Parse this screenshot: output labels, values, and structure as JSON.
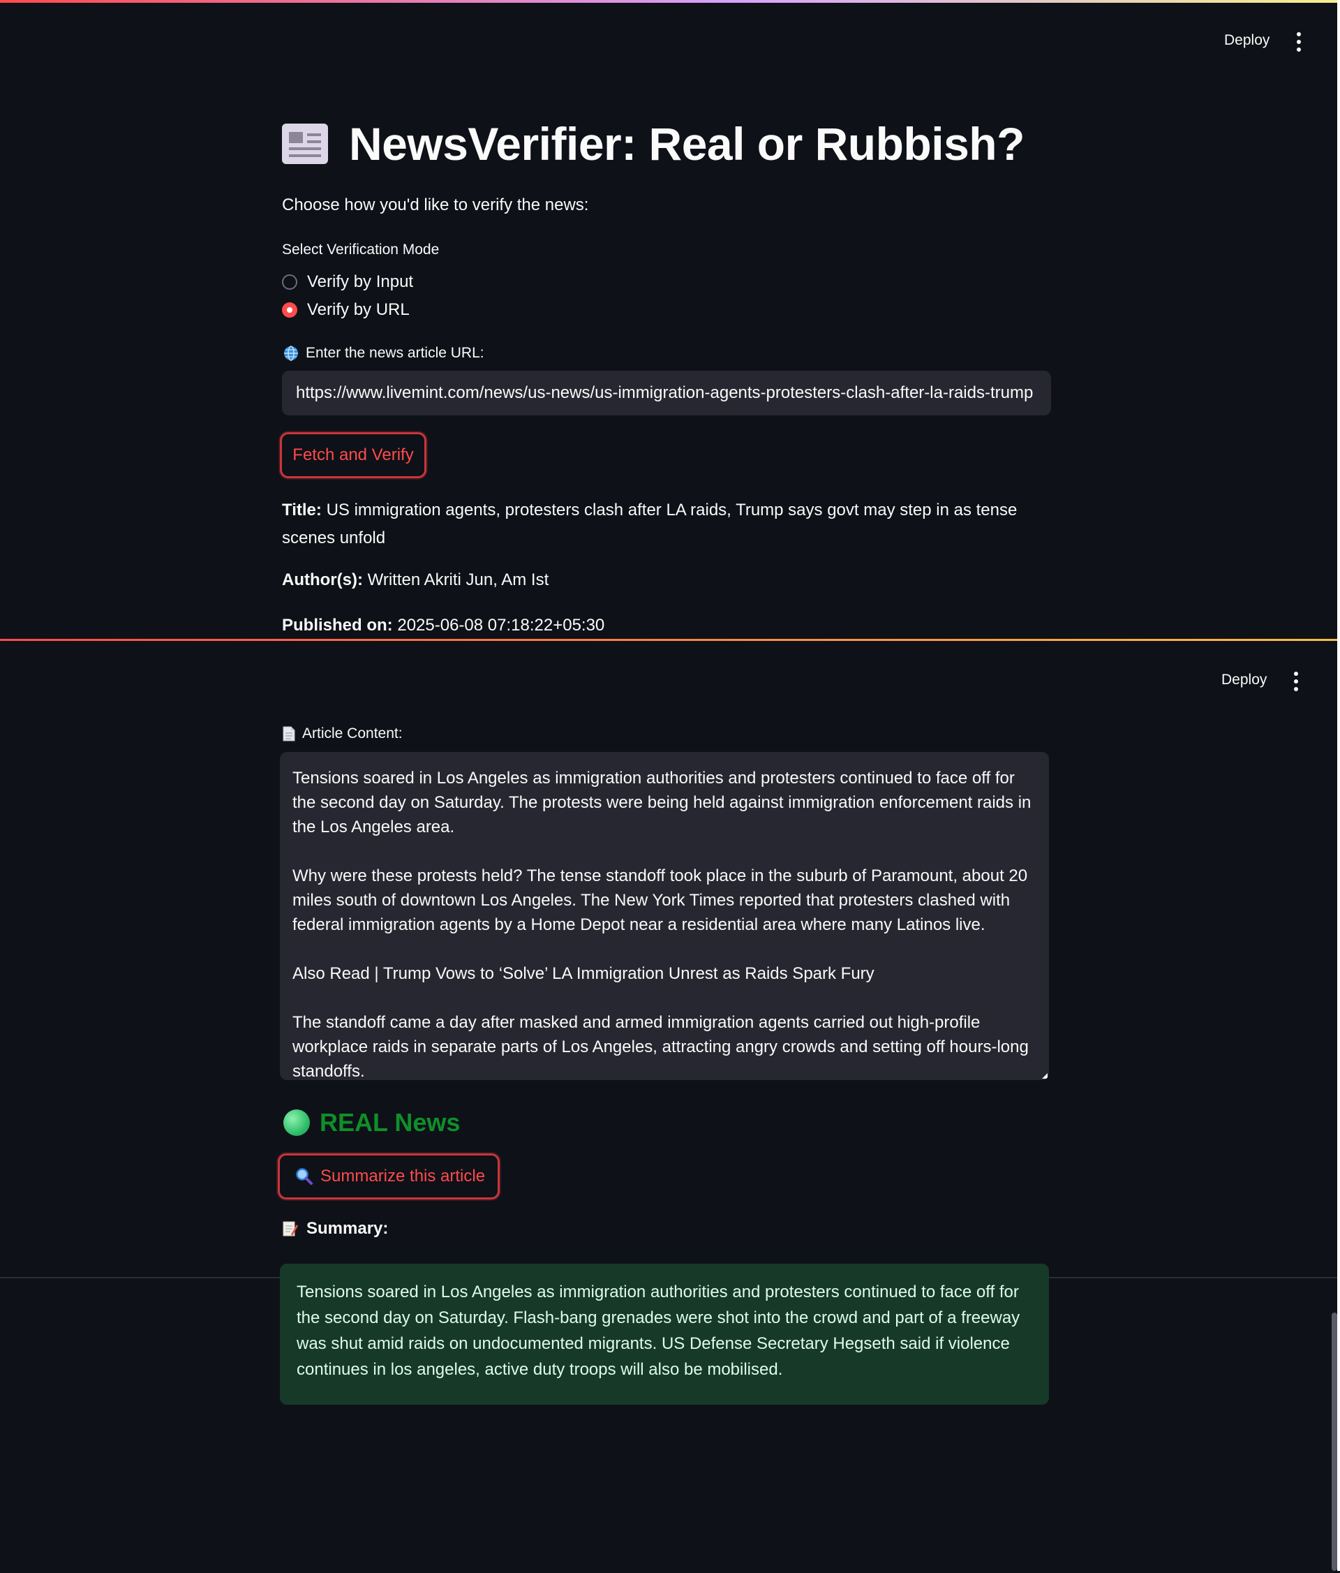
{
  "header": {
    "deploy_label": "Deploy"
  },
  "app": {
    "title": "NewsVerifier: Real or Rubbish?",
    "title_icon": "newspaper-icon",
    "subtitle": "Choose how you'd like to verify the news:"
  },
  "mode": {
    "label": "Select Verification Mode",
    "options": [
      "Verify by Input",
      "Verify by URL"
    ],
    "selected": "Verify by URL"
  },
  "url_field": {
    "icon": "globe-icon",
    "label": "Enter the news article URL:",
    "value": "https://www.livemint.com/news/us-news/us-immigration-agents-protesters-clash-after-la-raids-trump"
  },
  "fetch_button": {
    "label": "Fetch and Verify"
  },
  "meta": {
    "title_label": "Title:",
    "title_value": "US immigration agents, protesters clash after LA raids, Trump says govt may step in as tense scenes unfold",
    "author_label": "Author(s):",
    "author_value": "Written Akriti Jun, Am Ist",
    "published_label": "Published on:",
    "published_value": "2025-06-08 07:18:22+05:30"
  },
  "article": {
    "icon": "document-icon",
    "label": "Article Content:",
    "paragraphs": [
      "Tensions soared in Los Angeles as immigration authorities and protesters continued to face off for the second day on Saturday. The protests were being held against immigration enforcement raids in the Los Angeles area.",
      "Why were these protests held? The tense standoff took place in the suburb of Paramount, about 20 miles south of downtown Los Angeles. The New York Times reported that protesters clashed with federal immigration agents by a Home Depot near a residential area where many Latinos live.",
      "Also Read | Trump Vows to ‘Solve’ LA Immigration Unrest as Raids Spark Fury",
      "The standoff came a day after masked and armed immigration agents carried out high-profile workplace raids in separate parts of Los Angeles, attracting angry crowds and setting off hours-long standoffs."
    ]
  },
  "verdict": {
    "icon": "green-circle-icon",
    "label": "REAL News",
    "color": "#0f8f2a"
  },
  "summarize_button": {
    "icon": "magnifier-icon",
    "label": "Summarize this article"
  },
  "summary": {
    "icon": "memo-icon",
    "label": "Summary:",
    "text": "Tensions soared in Los Angeles as immigration authorities and protesters continued to face off for the second day on Saturday. Flash-bang grenades were shot into the crowd and part of a freeway was shut amid raids on undocumented migrants. US Defense Secretary Hegseth said if violence continues in los angeles, active duty troops will also be mobilised."
  },
  "colors": {
    "background": "#0e1117",
    "accent": "#ff4b4b",
    "input_bg": "#262730",
    "success_bg": "#173928"
  }
}
